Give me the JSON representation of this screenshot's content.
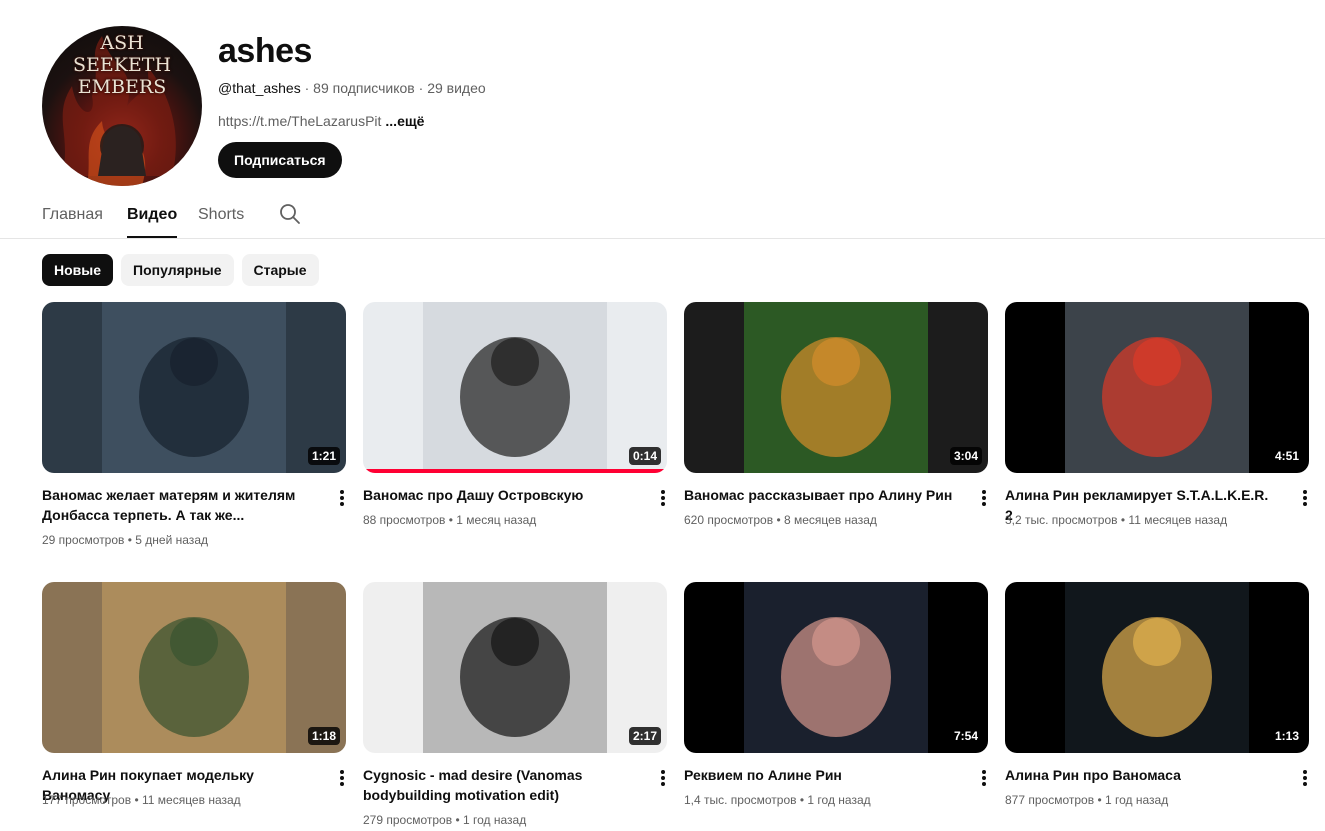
{
  "channel": {
    "avatar_lines": [
      "ASH",
      "SEEKETH",
      "EMBERS"
    ],
    "name": "ashes",
    "handle": "@that_ashes",
    "subscribers": "89 подписчиков",
    "video_count": "29 видео",
    "description": "https://t.me/TheLazarusPit",
    "more_label": "...ещё",
    "subscribe_label": "Подписаться"
  },
  "tabs": [
    {
      "label": "Главная",
      "active": false
    },
    {
      "label": "Видео",
      "active": true
    },
    {
      "label": "Shorts",
      "active": false
    }
  ],
  "chips": [
    {
      "label": "Новые",
      "active": true
    },
    {
      "label": "Популярные",
      "active": false
    },
    {
      "label": "Старые",
      "active": false
    }
  ],
  "videos": [
    {
      "title": "Ваномас желает матерям и жителям Донбасса терпеть. А так же...",
      "duration": "1:21",
      "views": "29 просмотров",
      "age": "5 дней назад",
      "thumb_palette": [
        "#2d3a46",
        "#4d6175",
        "#1a2430"
      ],
      "watched": false
    },
    {
      "title": "Ваномас про Дашу Островскую",
      "duration": "0:14",
      "views": "88 просмотров",
      "age": "1 месяц назад",
      "thumb_palette": [
        "#e9ecef",
        "#c7ccd2",
        "#2b2b2b"
      ],
      "watched": true
    },
    {
      "title": "Ваномас рассказывает про Алину Рин",
      "duration": "3:04",
      "views": "620 просмотров",
      "age": "8 месяцев назад",
      "thumb_palette": [
        "#1c1c1c",
        "#3b8d2c",
        "#c98a2a"
      ],
      "watched": false
    },
    {
      "title": "Алина Рин рекламирует S.T.A.L.K.E.R. 2",
      "duration": "4:51",
      "views": "3,2 тыс. просмотров",
      "age": "11 месяцев назад",
      "thumb_palette": [
        "#000000",
        "#6d7a86",
        "#d23a2a"
      ],
      "watched": false
    },
    {
      "title": "Алина Рин покупает модельку Ваномасу",
      "duration": "1:18",
      "views": "177 просмотров",
      "age": "11 месяцев назад",
      "thumb_palette": [
        "#8a7355",
        "#c9a063",
        "#3f5632"
      ],
      "watched": false
    },
    {
      "title": "Cygnosic - mad desire (Vanomas bodybuilding motivation edit)",
      "duration": "2:17",
      "views": "279 просмотров",
      "age": "1 год назад",
      "thumb_palette": [
        "#efefef",
        "#8b8b8b",
        "#1f1f1f"
      ],
      "watched": false
    },
    {
      "title": "Реквием по Алине Рин",
      "duration": "7:54",
      "views": "1,4 тыс. просмотров",
      "age": "1 год назад",
      "thumb_palette": [
        "#000000",
        "#2f3a52",
        "#c98f86"
      ],
      "watched": false
    },
    {
      "title": "Алина Рин про Ваномаса",
      "duration": "1:13",
      "views": "877 просмотров",
      "age": "1 год назад",
      "thumb_palette": [
        "#000000",
        "#1f2a33",
        "#d4a64a"
      ],
      "watched": false
    }
  ]
}
